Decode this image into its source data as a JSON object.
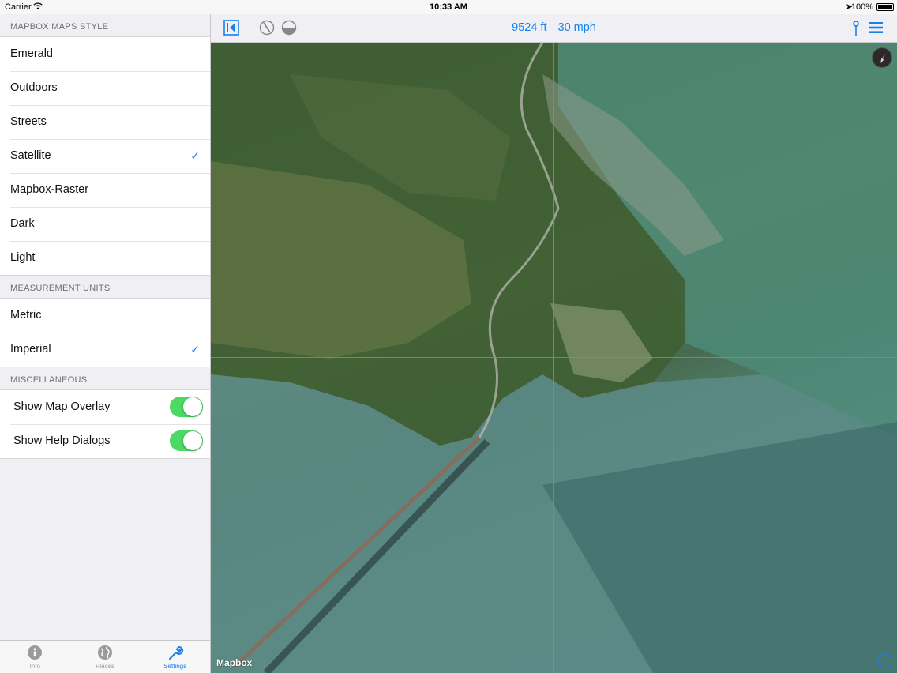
{
  "status_bar": {
    "carrier": "Carrier",
    "time": "10:33 AM",
    "battery": "100%"
  },
  "sidebar": {
    "map_style_header": "MAPBOX MAPS STYLE",
    "map_styles": [
      {
        "label": "Emerald",
        "selected": false
      },
      {
        "label": "Outdoors",
        "selected": false
      },
      {
        "label": "Streets",
        "selected": false
      },
      {
        "label": "Satellite",
        "selected": true
      },
      {
        "label": "Mapbox-Raster",
        "selected": false
      },
      {
        "label": "Dark",
        "selected": false
      },
      {
        "label": "Light",
        "selected": false
      }
    ],
    "units_header": "MEASUREMENT UNITS",
    "units": [
      {
        "label": "Metric",
        "selected": false
      },
      {
        "label": "Imperial",
        "selected": true
      }
    ],
    "misc_header": "MISCELLANEOUS",
    "misc": [
      {
        "label": "Show Map Overlay",
        "on": true
      },
      {
        "label": "Show Help Dialogs",
        "on": true
      }
    ],
    "checkmark": "✓"
  },
  "tabbar": {
    "tabs": [
      {
        "label": "Info",
        "icon": "info-icon",
        "active": false
      },
      {
        "label": "Places",
        "icon": "globe-icon",
        "active": false
      },
      {
        "label": "Settings",
        "icon": "wrench-icon",
        "active": true
      }
    ]
  },
  "map": {
    "altitude": "9524 ft",
    "speed": "30 mph",
    "attribution": "Mapbox",
    "info_glyph": "i"
  },
  "colors": {
    "accent": "#1a7fe8",
    "toggle_on": "#4cd964",
    "crosshair": "#1fcf2f"
  }
}
